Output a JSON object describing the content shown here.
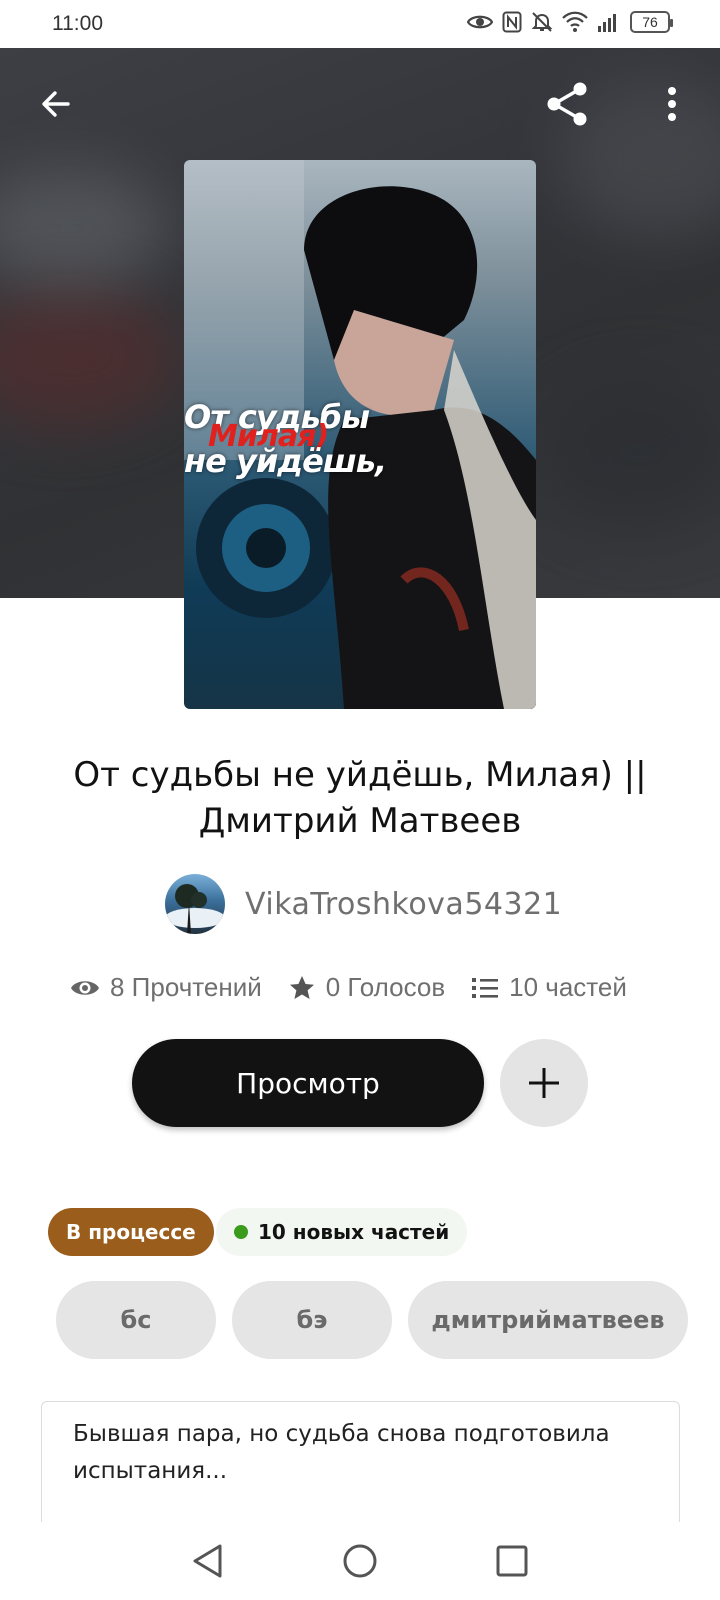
{
  "status_bar": {
    "time": "11:00",
    "battery": "76",
    "icons": [
      "eye-icon",
      "nfc-icon",
      "mute-icon",
      "wifi-icon",
      "signal-icon",
      "battery-icon"
    ]
  },
  "header": {
    "back_icon": "arrow-left-icon",
    "share_icon": "share-icon",
    "menu_icon": "more-vertical-icon"
  },
  "cover": {
    "line1": "От судьбы",
    "line2": "Милая)",
    "line3": "не уйдёшь,",
    "accent_color": "#e0211d"
  },
  "story": {
    "title": "От судьбы не уйдёшь, Милая) || Дмитрий Матвеев",
    "author": "VikaTroshkova54321"
  },
  "stats": {
    "reads": "8 Прочтений",
    "votes": "0 Голосов",
    "parts": "10 частей"
  },
  "actions": {
    "read_label": "Просмотр",
    "add_icon": "plus-icon"
  },
  "badges": {
    "status": "В процессе",
    "new_parts": "10 новых частей",
    "status_color": "#9a5d1b",
    "new_dot_color": "#3a9b1d"
  },
  "tags": [
    "бс",
    "бэ",
    "дмитрийматвеев"
  ],
  "description": "Бывшая пара, но судьба снова подготовила испытания...",
  "nav": {
    "back_icon": "triangle-back-icon",
    "home_icon": "circle-home-icon",
    "recents_icon": "square-recents-icon"
  }
}
